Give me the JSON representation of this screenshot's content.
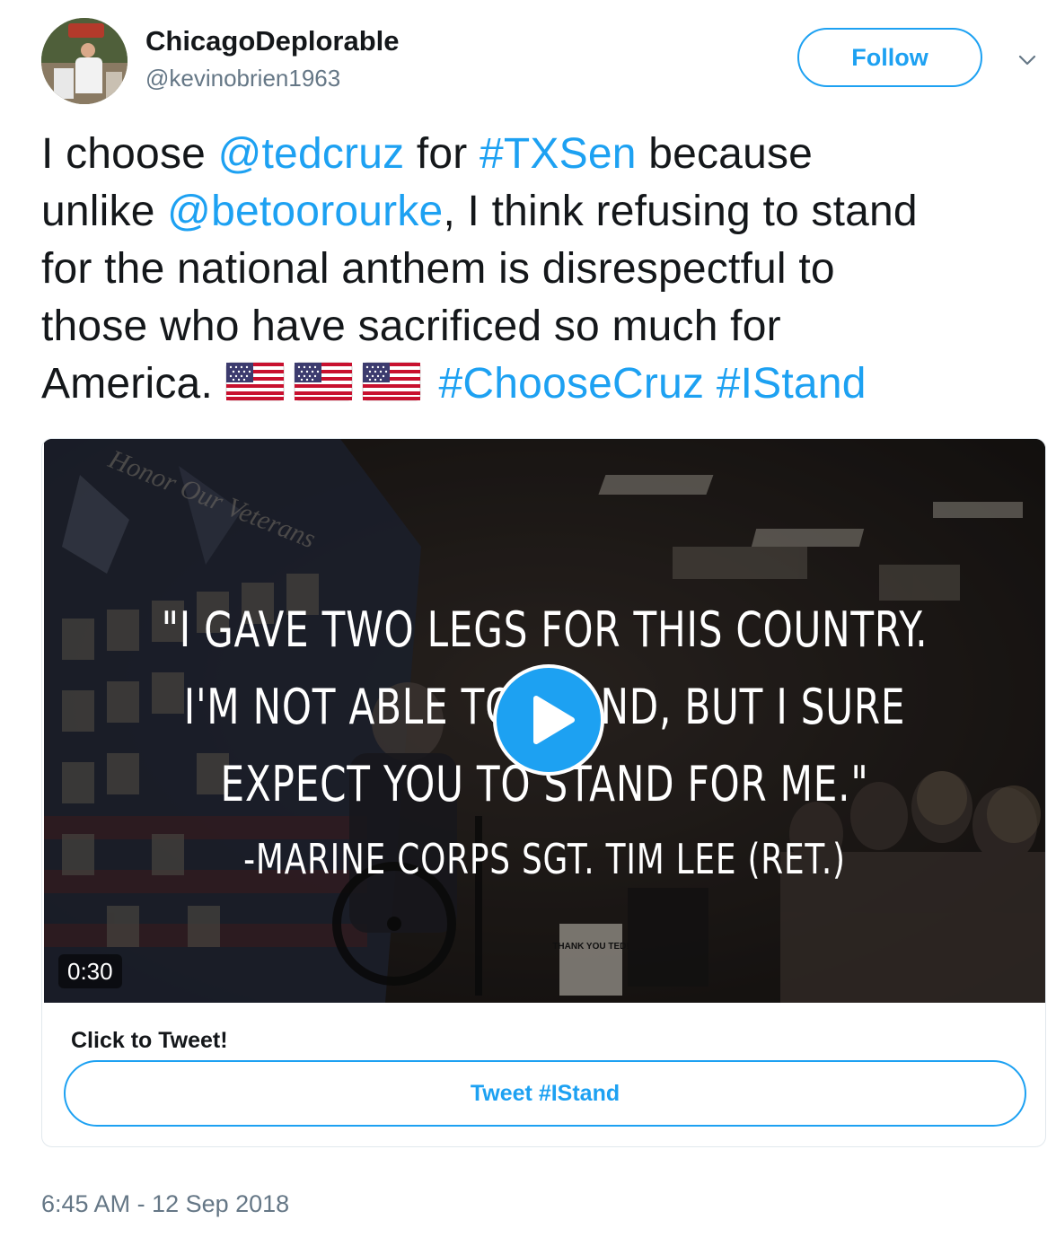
{
  "user": {
    "display_name": "ChicagoDeplorable",
    "handle": "@kevinobrien1963",
    "follow_label": "Follow"
  },
  "tweet": {
    "segments_line1": [
      "I choose ",
      "@tedcruz",
      " for ",
      "#TXSen",
      " because"
    ],
    "segments_line2": [
      "unlike ",
      "@betoorourke",
      ", I think refusing to stand"
    ],
    "line3": "for the national anthem is disrespectful to",
    "line4": "those who have sacrificed so much for",
    "line5_text": "America. ",
    "hashtag_choosecruz": "#ChooseCruz",
    "hashtag_istand": "#IStand",
    "emoji": [
      "us-flag-emoji",
      "us-flag-emoji",
      "us-flag-emoji"
    ]
  },
  "card": {
    "video": {
      "overlay_text_watermark": "Honor Our Veterans",
      "quote_lines": [
        "\"I GAVE TWO LEGS FOR THIS COUNTRY.",
        "I'M NOT ABLE TO STAND, BUT I SURE",
        "EXPECT YOU TO STAND FOR ME.\""
      ],
      "attribution": "-MARINE CORPS SGT. TIM LEE (RET.)",
      "duration": "0:30",
      "sign_text": "THANK YOU TED!"
    },
    "title": "Click to Tweet!",
    "button_label": "Tweet #IStand"
  },
  "timestamp": "6:45 AM - 12 Sep 2018",
  "colors": {
    "accent": "#1da1f2",
    "text": "#14171a",
    "secondary": "#657786",
    "border": "#e1e8ed"
  }
}
